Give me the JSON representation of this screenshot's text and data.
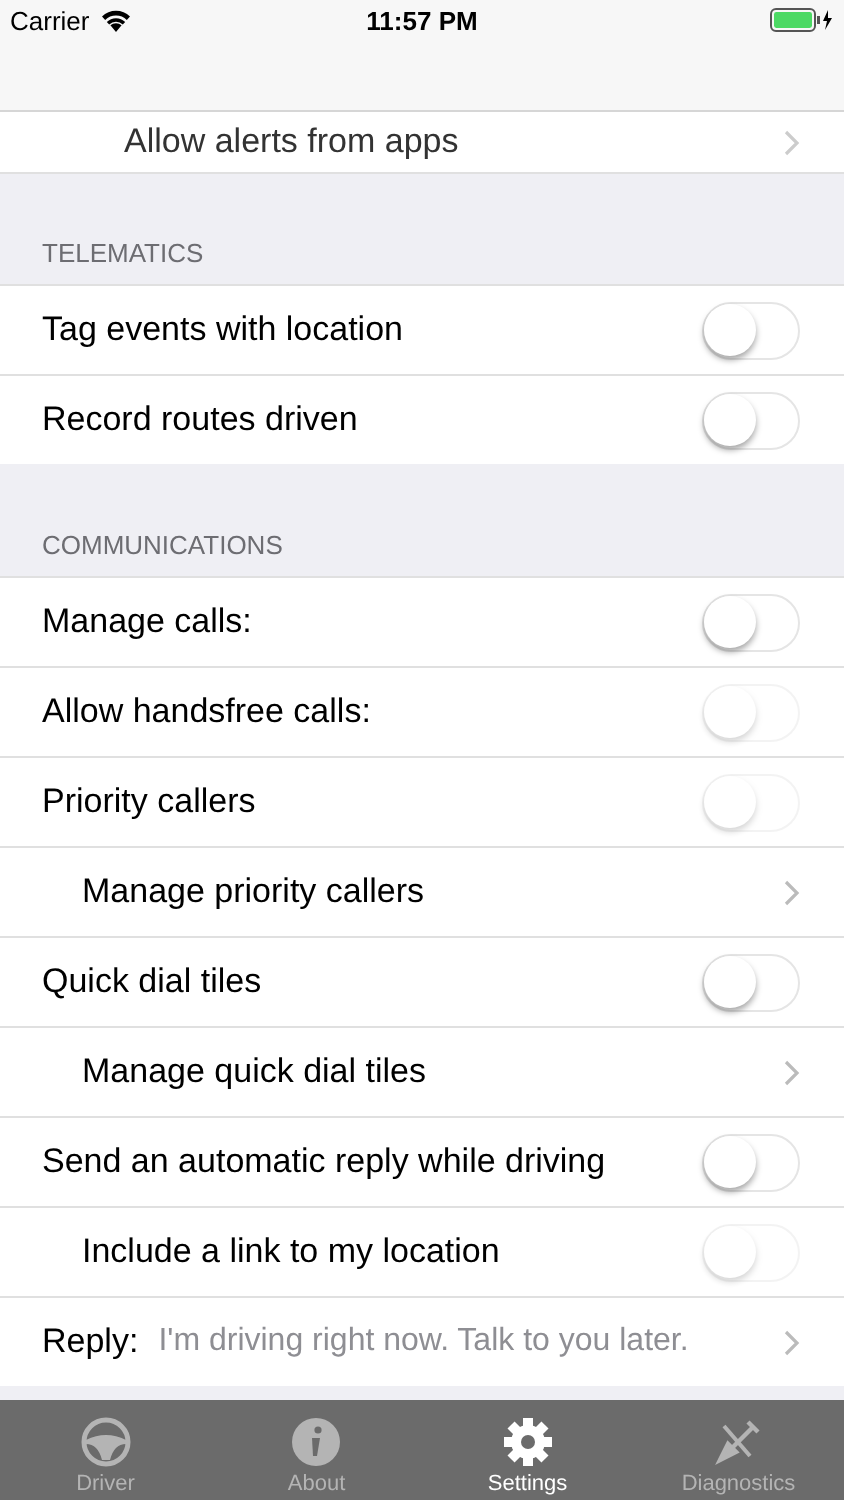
{
  "status_bar": {
    "carrier": "Carrier",
    "time": "11:57 PM"
  },
  "top_row": {
    "label": "Allow alerts from apps",
    "indented": true
  },
  "sections": [
    {
      "header": "TELEMATICS",
      "rows": [
        {
          "kind": "toggle",
          "label": "Tag events with location",
          "indented": false,
          "on": false,
          "disabled": false
        },
        {
          "kind": "toggle",
          "label": "Record routes driven",
          "indented": false,
          "on": false,
          "disabled": false
        }
      ]
    },
    {
      "header": "COMMUNICATIONS",
      "rows": [
        {
          "kind": "toggle",
          "label": "Manage calls:",
          "indented": false,
          "on": false,
          "disabled": false
        },
        {
          "kind": "toggle",
          "label": "Allow handsfree calls:",
          "indented": false,
          "on": false,
          "disabled": true
        },
        {
          "kind": "toggle",
          "label": "Priority callers",
          "indented": false,
          "on": false,
          "disabled": true
        },
        {
          "kind": "link",
          "label": "Manage priority callers",
          "indented": true
        },
        {
          "kind": "toggle",
          "label": "Quick dial tiles",
          "indented": false,
          "on": false,
          "disabled": false
        },
        {
          "kind": "link",
          "label": "Manage quick dial tiles",
          "indented": true
        },
        {
          "kind": "toggle",
          "label": "Send an automatic reply while driving",
          "indented": false,
          "on": false,
          "disabled": false
        },
        {
          "kind": "toggle",
          "label": "Include a link to my location",
          "indented": true,
          "on": false,
          "disabled": true
        },
        {
          "kind": "reply",
          "label": "Reply:",
          "value": "I'm driving right now. Talk to you later."
        }
      ]
    }
  ],
  "tabs": [
    {
      "label": "Driver",
      "selected": false
    },
    {
      "label": "About",
      "selected": false
    },
    {
      "label": "Settings",
      "selected": true
    },
    {
      "label": "Diagnostics",
      "selected": false
    }
  ]
}
